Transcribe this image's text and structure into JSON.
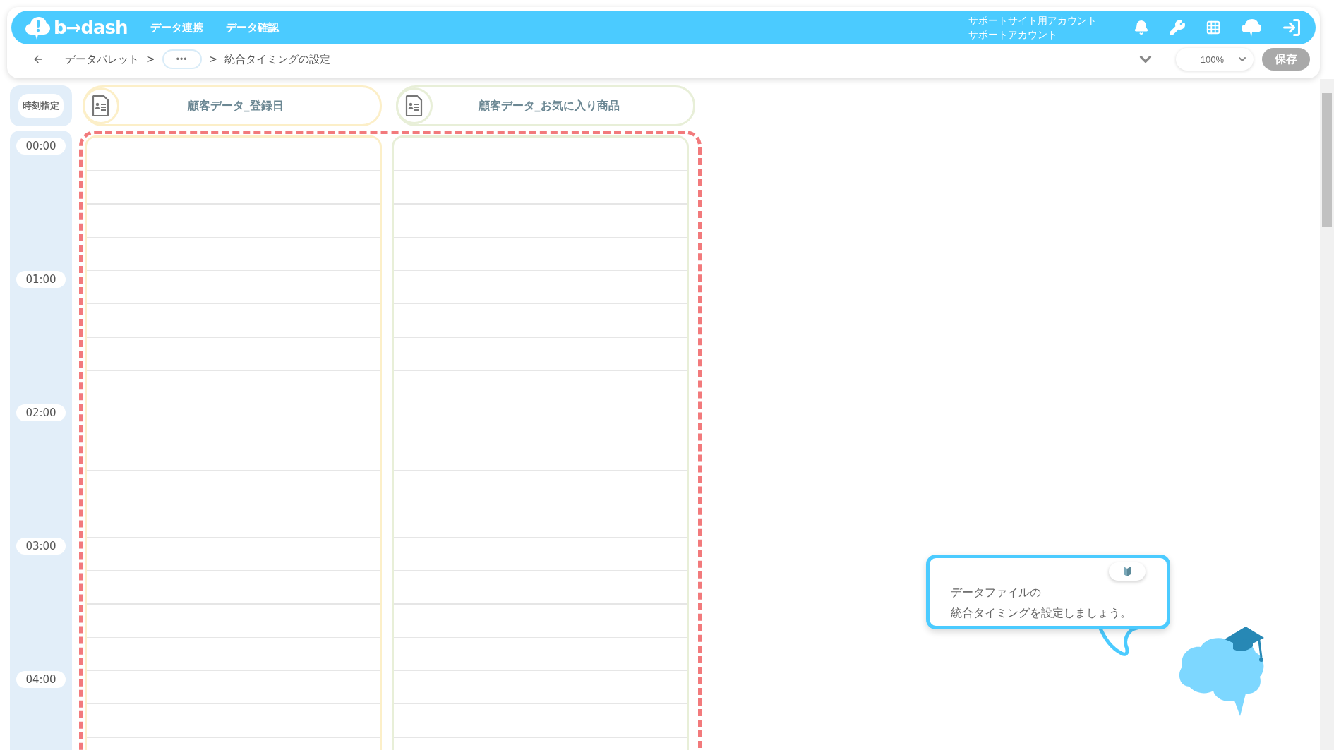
{
  "header": {
    "logo": "b→dash",
    "nav": [
      "データ連携",
      "データ確認"
    ],
    "account": [
      "サポートサイト用アカウント",
      "サポートアカウント"
    ]
  },
  "breadcrumb": [
    {
      "kind": "link",
      "label": "データパレット"
    },
    {
      "kind": "sep",
      "label": ">"
    },
    {
      "kind": "more",
      "label": "•••"
    },
    {
      "kind": "sep",
      "label": ">"
    },
    {
      "kind": "current",
      "label": "統合タイミングの設定"
    }
  ],
  "toolbar": {
    "zoom": "100%",
    "save": {
      "label": "保存",
      "disabled": true
    }
  },
  "timeline": {
    "header": "時刻指定",
    "hours": [
      "00:00",
      "01:00",
      "02:00",
      "03:00",
      "04:00"
    ]
  },
  "columns": [
    {
      "title": "顧客データ_登録日",
      "color": "#fcefc8"
    },
    {
      "title": "顧客データ_お気に入り商品",
      "color": "#e8efd8"
    }
  ],
  "tip": {
    "lines": [
      "データファイルの",
      "統合タイミングを設定しましょう。"
    ]
  }
}
